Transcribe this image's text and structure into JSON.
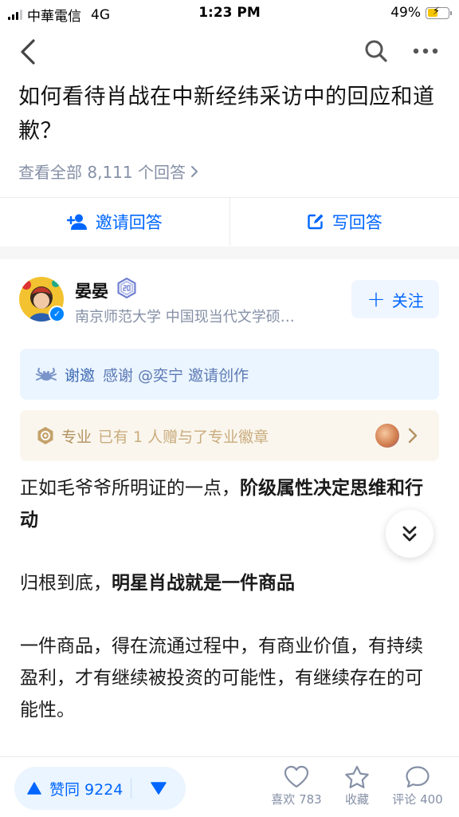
{
  "status_bar": {
    "carrier": "中華電信",
    "network": "4G",
    "time": "1:23 PM",
    "battery": "49%",
    "battery_level": 0.49
  },
  "nav": {
    "back_icon": "chevron-left-icon",
    "search_icon": "search-icon",
    "more_icon": "more-dots-icon"
  },
  "question": {
    "title": "如何看待肖战在中新经纬采访中的回应和道歉？",
    "view_all": "查看全部 8,111 个回答"
  },
  "actions": {
    "invite_label": "邀请回答",
    "write_label": "写回答"
  },
  "author": {
    "name": "晏晏",
    "bio": "南京师范大学 中国现当代文学硕…",
    "follow_label": "关注"
  },
  "invite_card": {
    "prefix": "谢邀",
    "text": "感谢 @奕宁 邀请创作"
  },
  "badge_card": {
    "label": "专业",
    "text": "已有 1 人赠与了专业徽章"
  },
  "content": {
    "p1_normal": "正如毛爷爷所明证的一点，",
    "p1_bold": "阶级属性决定思维和行动",
    "p2_normal": "归根到底，",
    "p2_bold": "明星肖战就是一件商品",
    "p3": "一件商品，得在流通过程中，有商业价值，有持续盈利，才有继续被投资的可能性，有继续存在的可能性。"
  },
  "bottom_bar": {
    "vote_label": "赞同 9224",
    "like_label": "喜欢 783",
    "favorite_label": "收藏",
    "comment_label": "评论 400"
  },
  "colors": {
    "accent": "#0066ff",
    "muted": "#8590a6",
    "invite_bg": "#ebf5ff",
    "badge_bg": "#faf6ee"
  }
}
